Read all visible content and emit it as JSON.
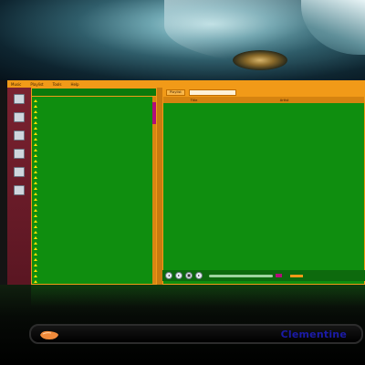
{
  "menubar": [
    "Music",
    "Playlist",
    "Tools",
    "Help"
  ],
  "sidebar": {
    "items": [
      {
        "name": "library-icon",
        "label": ""
      },
      {
        "name": "files-icon",
        "label": ""
      },
      {
        "name": "internet-icon",
        "label": ""
      },
      {
        "name": "devices-icon",
        "label": ""
      },
      {
        "name": "song-info-icon",
        "label": ""
      },
      {
        "name": "artist-info-icon",
        "label": ""
      }
    ]
  },
  "library": {
    "header": "",
    "items": [
      "",
      "",
      "",
      "",
      "",
      "",
      "",
      "",
      "",
      "",
      "",
      "",
      "",
      "",
      "",
      "",
      "",
      "",
      "",
      "",
      "",
      "",
      "",
      "",
      "",
      "",
      "",
      "",
      "",
      "",
      "",
      "",
      "",
      ""
    ]
  },
  "playlist": {
    "tabs": [
      "Playlist"
    ],
    "columns": [
      "",
      "Title",
      "Artist"
    ],
    "rows": [
      [
        "",
        "",
        ""
      ],
      [
        "",
        "",
        ""
      ],
      [
        "",
        "",
        ""
      ],
      [
        "",
        "",
        ""
      ],
      [
        "",
        "",
        ""
      ],
      [
        "",
        "",
        ""
      ],
      [
        "",
        "",
        ""
      ],
      [
        "",
        "",
        ""
      ],
      [
        "",
        "",
        ""
      ],
      [
        "",
        "",
        ""
      ],
      [
        "",
        "",
        ""
      ],
      [
        "",
        "",
        ""
      ],
      [
        "",
        "",
        ""
      ],
      [
        "",
        "",
        ""
      ],
      [
        "",
        "",
        ""
      ],
      [
        "",
        "",
        ""
      ],
      [
        "",
        "",
        ""
      ],
      [
        "",
        "",
        ""
      ],
      [
        "",
        "",
        ""
      ],
      [
        "",
        "",
        ""
      ],
      [
        "",
        "",
        ""
      ],
      [
        "",
        "",
        ""
      ],
      [
        "",
        "",
        ""
      ],
      [
        "",
        "",
        ""
      ],
      [
        "",
        "",
        ""
      ],
      [
        "",
        "",
        ""
      ],
      [
        "",
        "",
        ""
      ],
      [
        "",
        "",
        ""
      ],
      [
        "",
        "",
        ""
      ],
      [
        "",
        "",
        ""
      ],
      [
        "",
        "",
        ""
      ],
      [
        "",
        "",
        ""
      ],
      [
        "",
        "",
        ""
      ],
      [
        "",
        "",
        ""
      ]
    ]
  },
  "controls": [
    "previous-icon",
    "play-icon",
    "stop-icon",
    "next-icon"
  ],
  "panel": {
    "title": "Clementine"
  },
  "colors": {
    "accent": "#f19a18",
    "list_bg": "#0f8e0f",
    "title": "#1b1ba8",
    "highlight": "#b20c7a"
  }
}
